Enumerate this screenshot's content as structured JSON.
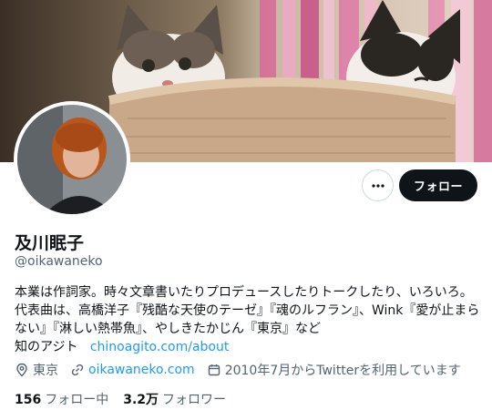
{
  "profile": {
    "display_name": "及川眠子",
    "handle": "@oikawaneko",
    "bio_text": "本業は作詞家。時々文章書いたりプロデュースしたりトークしたり、いろいろ。 代表曲は、高橋洋子『残酷な天使のテーゼ』『魂のルフラン』、Wink『愛が止まらない』『淋しい熱帯魚』、やしきたかじん『東京』など",
    "bio_link_prefix": "知のアジト",
    "bio_link": "chinoagito.com/about",
    "location": "東京",
    "website": "oikawaneko.com",
    "joined": "2010年7月からTwitterを利用しています",
    "following_count": "156",
    "following_label": "フォロー中",
    "followers_count": "3.2万",
    "followers_label": "フォロワー"
  },
  "actions": {
    "more_icon": "more-horizontal-icon",
    "follow_label": "フォロー"
  },
  "colors": {
    "link": "#1d9bf0",
    "text_primary": "#0f1419",
    "text_secondary": "#536471",
    "button_bg": "#0f1419"
  }
}
